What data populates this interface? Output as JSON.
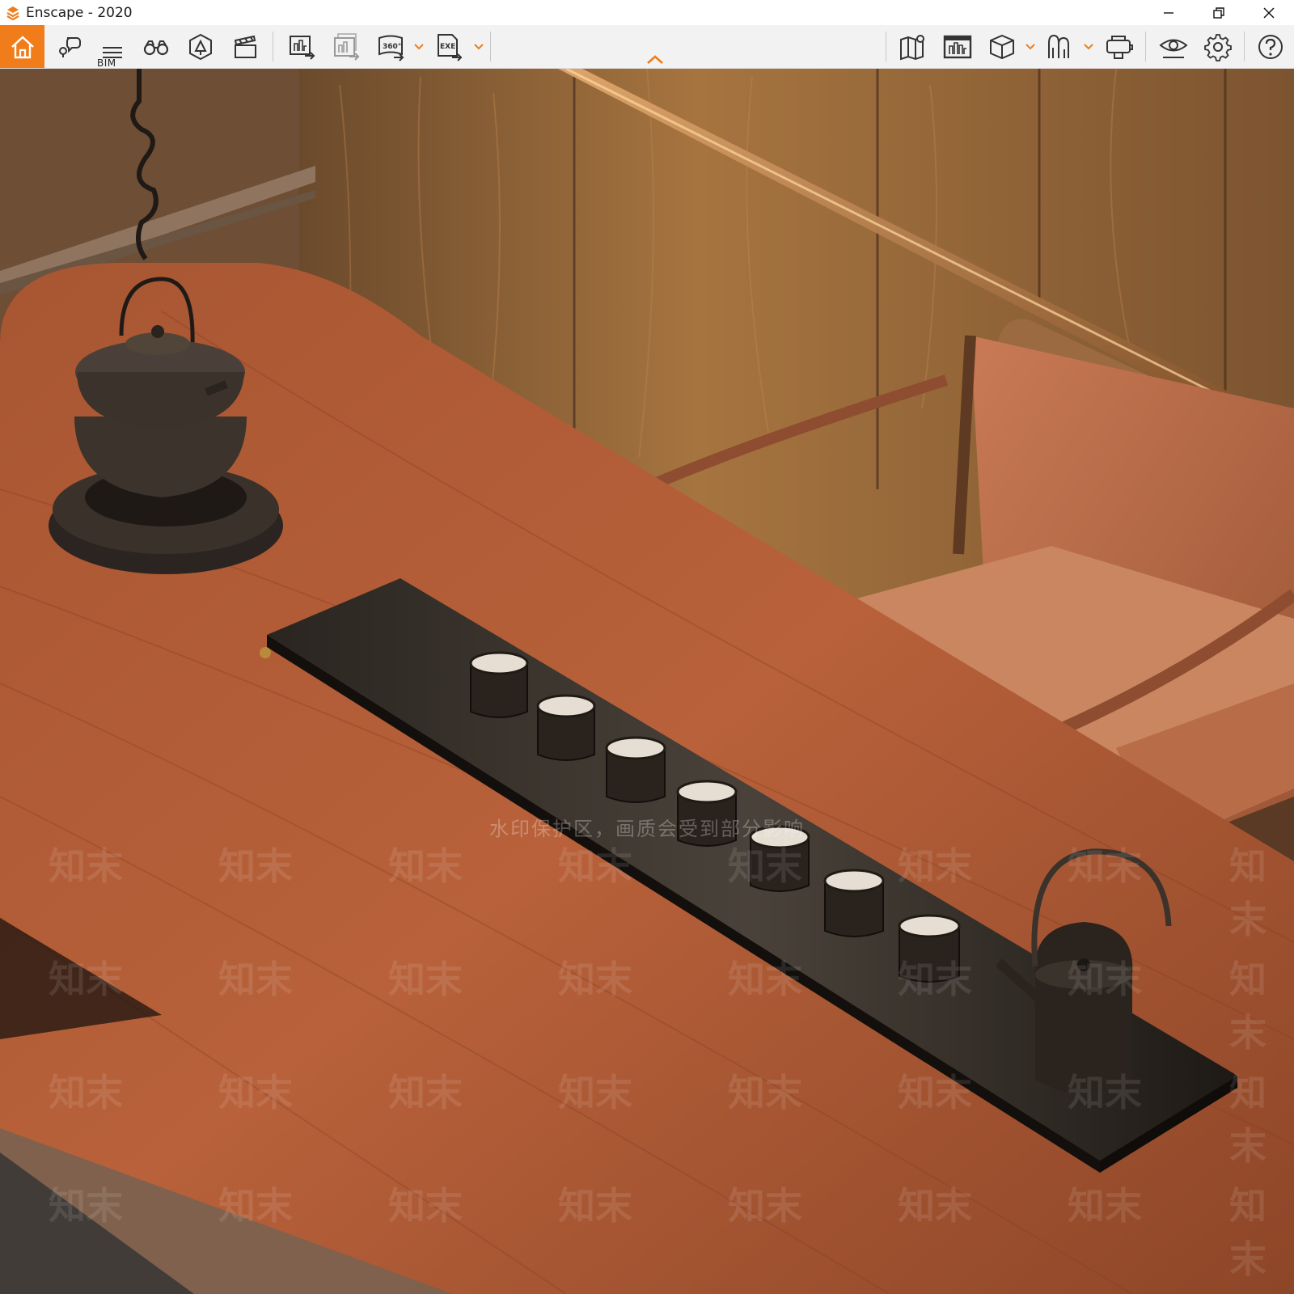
{
  "window": {
    "title": "Enscape - 2020",
    "controls": [
      "minimize",
      "restore",
      "close"
    ]
  },
  "toolbar": {
    "bim_label": "BIM",
    "left_tools": [
      {
        "name": "home-icon"
      },
      {
        "name": "pin-icon"
      },
      {
        "name": "bim-info-icon"
      },
      {
        "name": "binoculars-icon"
      },
      {
        "name": "asset-library-icon"
      },
      {
        "name": "video-editor-icon"
      }
    ],
    "export_tools": [
      {
        "name": "screenshot-export-icon"
      },
      {
        "name": "batch-render-icon"
      },
      {
        "name": "panorama-360-icon",
        "label": "360°"
      },
      {
        "name": "exe-export-icon",
        "label": "EXE"
      }
    ],
    "right_tools": [
      {
        "name": "map-icon"
      },
      {
        "name": "views-icon"
      },
      {
        "name": "cube-icon"
      },
      {
        "name": "vr-headset-icon"
      },
      {
        "name": "cloud-upload-icon"
      },
      {
        "name": "eye-icon"
      },
      {
        "name": "settings-gear-icon"
      },
      {
        "name": "help-icon"
      }
    ],
    "accent_color": "#f07d1a"
  },
  "viewport": {
    "watermark_banner": "水印保护区，画质会受到部分影响",
    "watermark_mark": "知末"
  }
}
